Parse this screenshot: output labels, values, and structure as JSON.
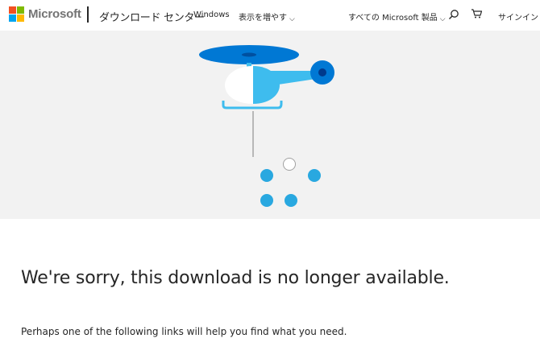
{
  "header": {
    "brand": "Microsoft",
    "site_title": "ダウンロード センター",
    "nav": {
      "windows": "Windows",
      "more": "表示を増やす"
    },
    "all_microsoft": "すべての Microsoft 製品",
    "sign_in": "サインイン",
    "logo_colors": [
      "#f25022",
      "#7fba00",
      "#00a4ef",
      "#ffb900"
    ]
  },
  "main": {
    "headline": "We're sorry, this download is no longer available.",
    "subtext": "Perhaps one of the following links will help you find what you need."
  },
  "theme": {
    "accent": "#0078d4",
    "illustration_light_blue": "#3ebcee",
    "hero_background": "#f2f2f2"
  }
}
